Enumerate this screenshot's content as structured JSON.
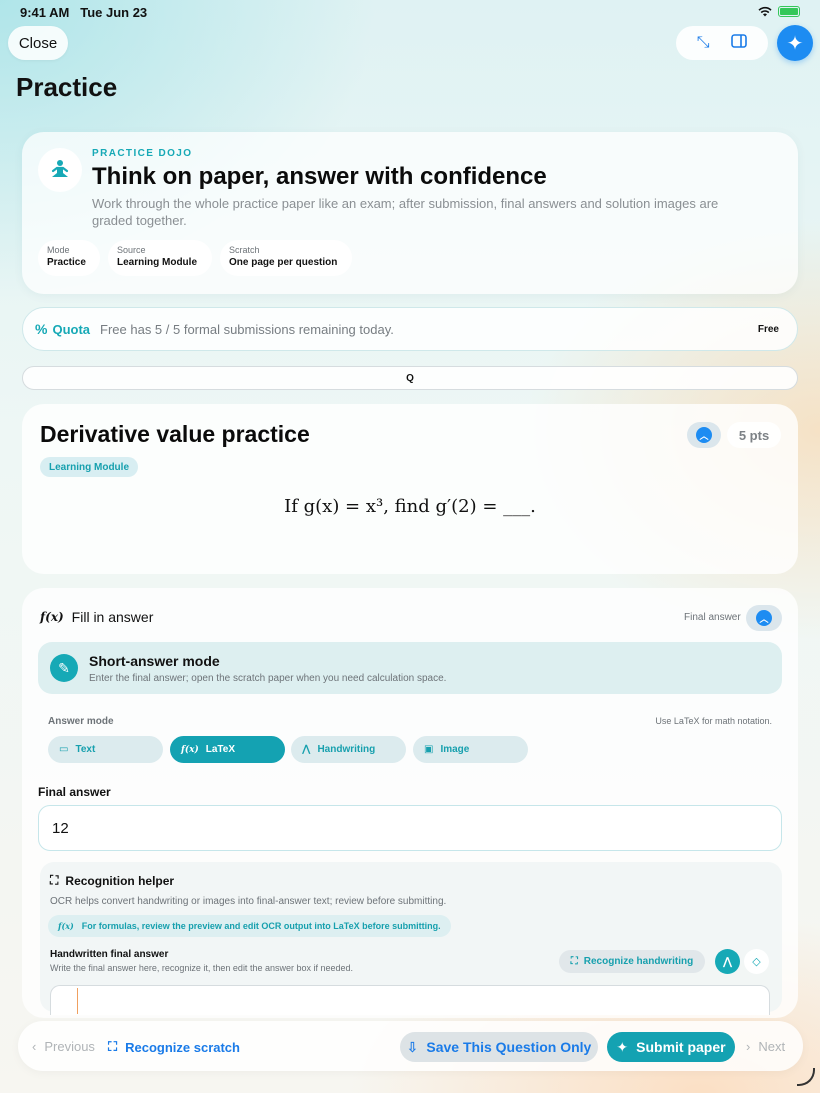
{
  "status_bar": {
    "time": "9:41 AM",
    "date": "Tue Jun 23"
  },
  "top_bar": {
    "close_label": "Close"
  },
  "page_title": "Practice",
  "hero": {
    "eyebrow": "PRACTICE DOJO",
    "title": "Think on paper, answer with confidence",
    "description": "Work through the whole practice paper like an exam; after submission, final answers and solution images are graded together.",
    "meta": [
      {
        "key": "Mode",
        "value": "Practice"
      },
      {
        "key": "Source",
        "value": "Learning Module"
      },
      {
        "key": "Scratch",
        "value": "One page per question"
      }
    ]
  },
  "quota": {
    "label": "Quota",
    "text": "Free has 5 / 5 formal submissions remaining today.",
    "tier": "Free",
    "remaining": 5,
    "total": 5
  },
  "question_bar": {
    "label": "Q"
  },
  "question": {
    "title": "Derivative value practice",
    "points": "5 pts",
    "source_tag": "Learning Module",
    "formula": "If g(x) = x³, find g′(2) = ___."
  },
  "answer": {
    "section_title": "Fill in answer",
    "final_answer_label": "Final answer",
    "mode_card": {
      "title": "Short-answer mode",
      "description": "Enter the final answer; open the scratch paper when you need calculation space."
    },
    "answer_mode_label": "Answer mode",
    "answer_mode_hint": "Use LaTeX for math notation.",
    "modes": [
      "Text",
      "LaTeX",
      "Handwriting",
      "Image"
    ],
    "active_mode": "LaTeX",
    "final_answer_title": "Final answer",
    "final_answer_value": "12"
  },
  "recognition": {
    "title": "Recognition helper",
    "description": "OCR helps convert handwriting or images into final-answer text; review before submitting.",
    "tip": "For formulas, review the preview and edit OCR output into LaTeX before submitting.",
    "handwritten_label": "Handwritten final answer",
    "handwritten_desc": "Write the final answer here, recognize it, then edit the answer box if needed.",
    "recognize_button": "Recognize handwriting"
  },
  "bottom_bar": {
    "previous": "Previous",
    "recognize_scratch": "Recognize scratch",
    "save": "Save This Question Only",
    "submit": "Submit paper",
    "next": "Next"
  },
  "colors": {
    "accent": "#14a2b2",
    "link": "#1a7be8",
    "ai": "#1d8cf2"
  }
}
